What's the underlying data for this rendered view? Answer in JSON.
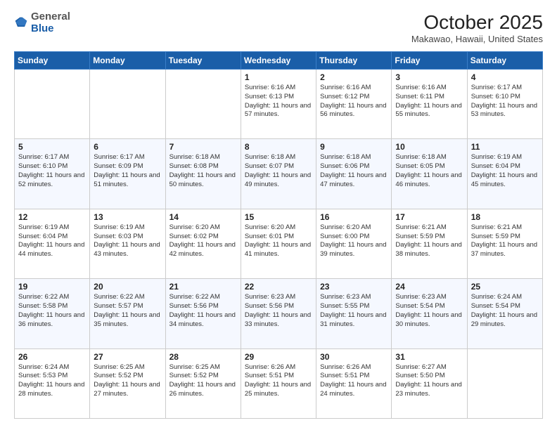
{
  "header": {
    "logo": {
      "line1": "General",
      "line2": "Blue"
    },
    "title": "October 2025",
    "location": "Makawao, Hawaii, United States"
  },
  "weekdays": [
    "Sunday",
    "Monday",
    "Tuesday",
    "Wednesday",
    "Thursday",
    "Friday",
    "Saturday"
  ],
  "weeks": [
    [
      {
        "day": "",
        "info": ""
      },
      {
        "day": "",
        "info": ""
      },
      {
        "day": "",
        "info": ""
      },
      {
        "day": "1",
        "info": "Sunrise: 6:16 AM\nSunset: 6:13 PM\nDaylight: 11 hours\nand 57 minutes."
      },
      {
        "day": "2",
        "info": "Sunrise: 6:16 AM\nSunset: 6:12 PM\nDaylight: 11 hours\nand 56 minutes."
      },
      {
        "day": "3",
        "info": "Sunrise: 6:16 AM\nSunset: 6:11 PM\nDaylight: 11 hours\nand 55 minutes."
      },
      {
        "day": "4",
        "info": "Sunrise: 6:17 AM\nSunset: 6:10 PM\nDaylight: 11 hours\nand 53 minutes."
      }
    ],
    [
      {
        "day": "5",
        "info": "Sunrise: 6:17 AM\nSunset: 6:10 PM\nDaylight: 11 hours\nand 52 minutes."
      },
      {
        "day": "6",
        "info": "Sunrise: 6:17 AM\nSunset: 6:09 PM\nDaylight: 11 hours\nand 51 minutes."
      },
      {
        "day": "7",
        "info": "Sunrise: 6:18 AM\nSunset: 6:08 PM\nDaylight: 11 hours\nand 50 minutes."
      },
      {
        "day": "8",
        "info": "Sunrise: 6:18 AM\nSunset: 6:07 PM\nDaylight: 11 hours\nand 49 minutes."
      },
      {
        "day": "9",
        "info": "Sunrise: 6:18 AM\nSunset: 6:06 PM\nDaylight: 11 hours\nand 47 minutes."
      },
      {
        "day": "10",
        "info": "Sunrise: 6:18 AM\nSunset: 6:05 PM\nDaylight: 11 hours\nand 46 minutes."
      },
      {
        "day": "11",
        "info": "Sunrise: 6:19 AM\nSunset: 6:04 PM\nDaylight: 11 hours\nand 45 minutes."
      }
    ],
    [
      {
        "day": "12",
        "info": "Sunrise: 6:19 AM\nSunset: 6:04 PM\nDaylight: 11 hours\nand 44 minutes."
      },
      {
        "day": "13",
        "info": "Sunrise: 6:19 AM\nSunset: 6:03 PM\nDaylight: 11 hours\nand 43 minutes."
      },
      {
        "day": "14",
        "info": "Sunrise: 6:20 AM\nSunset: 6:02 PM\nDaylight: 11 hours\nand 42 minutes."
      },
      {
        "day": "15",
        "info": "Sunrise: 6:20 AM\nSunset: 6:01 PM\nDaylight: 11 hours\nand 41 minutes."
      },
      {
        "day": "16",
        "info": "Sunrise: 6:20 AM\nSunset: 6:00 PM\nDaylight: 11 hours\nand 39 minutes."
      },
      {
        "day": "17",
        "info": "Sunrise: 6:21 AM\nSunset: 5:59 PM\nDaylight: 11 hours\nand 38 minutes."
      },
      {
        "day": "18",
        "info": "Sunrise: 6:21 AM\nSunset: 5:59 PM\nDaylight: 11 hours\nand 37 minutes."
      }
    ],
    [
      {
        "day": "19",
        "info": "Sunrise: 6:22 AM\nSunset: 5:58 PM\nDaylight: 11 hours\nand 36 minutes."
      },
      {
        "day": "20",
        "info": "Sunrise: 6:22 AM\nSunset: 5:57 PM\nDaylight: 11 hours\nand 35 minutes."
      },
      {
        "day": "21",
        "info": "Sunrise: 6:22 AM\nSunset: 5:56 PM\nDaylight: 11 hours\nand 34 minutes."
      },
      {
        "day": "22",
        "info": "Sunrise: 6:23 AM\nSunset: 5:56 PM\nDaylight: 11 hours\nand 33 minutes."
      },
      {
        "day": "23",
        "info": "Sunrise: 6:23 AM\nSunset: 5:55 PM\nDaylight: 11 hours\nand 31 minutes."
      },
      {
        "day": "24",
        "info": "Sunrise: 6:23 AM\nSunset: 5:54 PM\nDaylight: 11 hours\nand 30 minutes."
      },
      {
        "day": "25",
        "info": "Sunrise: 6:24 AM\nSunset: 5:54 PM\nDaylight: 11 hours\nand 29 minutes."
      }
    ],
    [
      {
        "day": "26",
        "info": "Sunrise: 6:24 AM\nSunset: 5:53 PM\nDaylight: 11 hours\nand 28 minutes."
      },
      {
        "day": "27",
        "info": "Sunrise: 6:25 AM\nSunset: 5:52 PM\nDaylight: 11 hours\nand 27 minutes."
      },
      {
        "day": "28",
        "info": "Sunrise: 6:25 AM\nSunset: 5:52 PM\nDaylight: 11 hours\nand 26 minutes."
      },
      {
        "day": "29",
        "info": "Sunrise: 6:26 AM\nSunset: 5:51 PM\nDaylight: 11 hours\nand 25 minutes."
      },
      {
        "day": "30",
        "info": "Sunrise: 6:26 AM\nSunset: 5:51 PM\nDaylight: 11 hours\nand 24 minutes."
      },
      {
        "day": "31",
        "info": "Sunrise: 6:27 AM\nSunset: 5:50 PM\nDaylight: 11 hours\nand 23 minutes."
      },
      {
        "day": "",
        "info": ""
      }
    ]
  ]
}
